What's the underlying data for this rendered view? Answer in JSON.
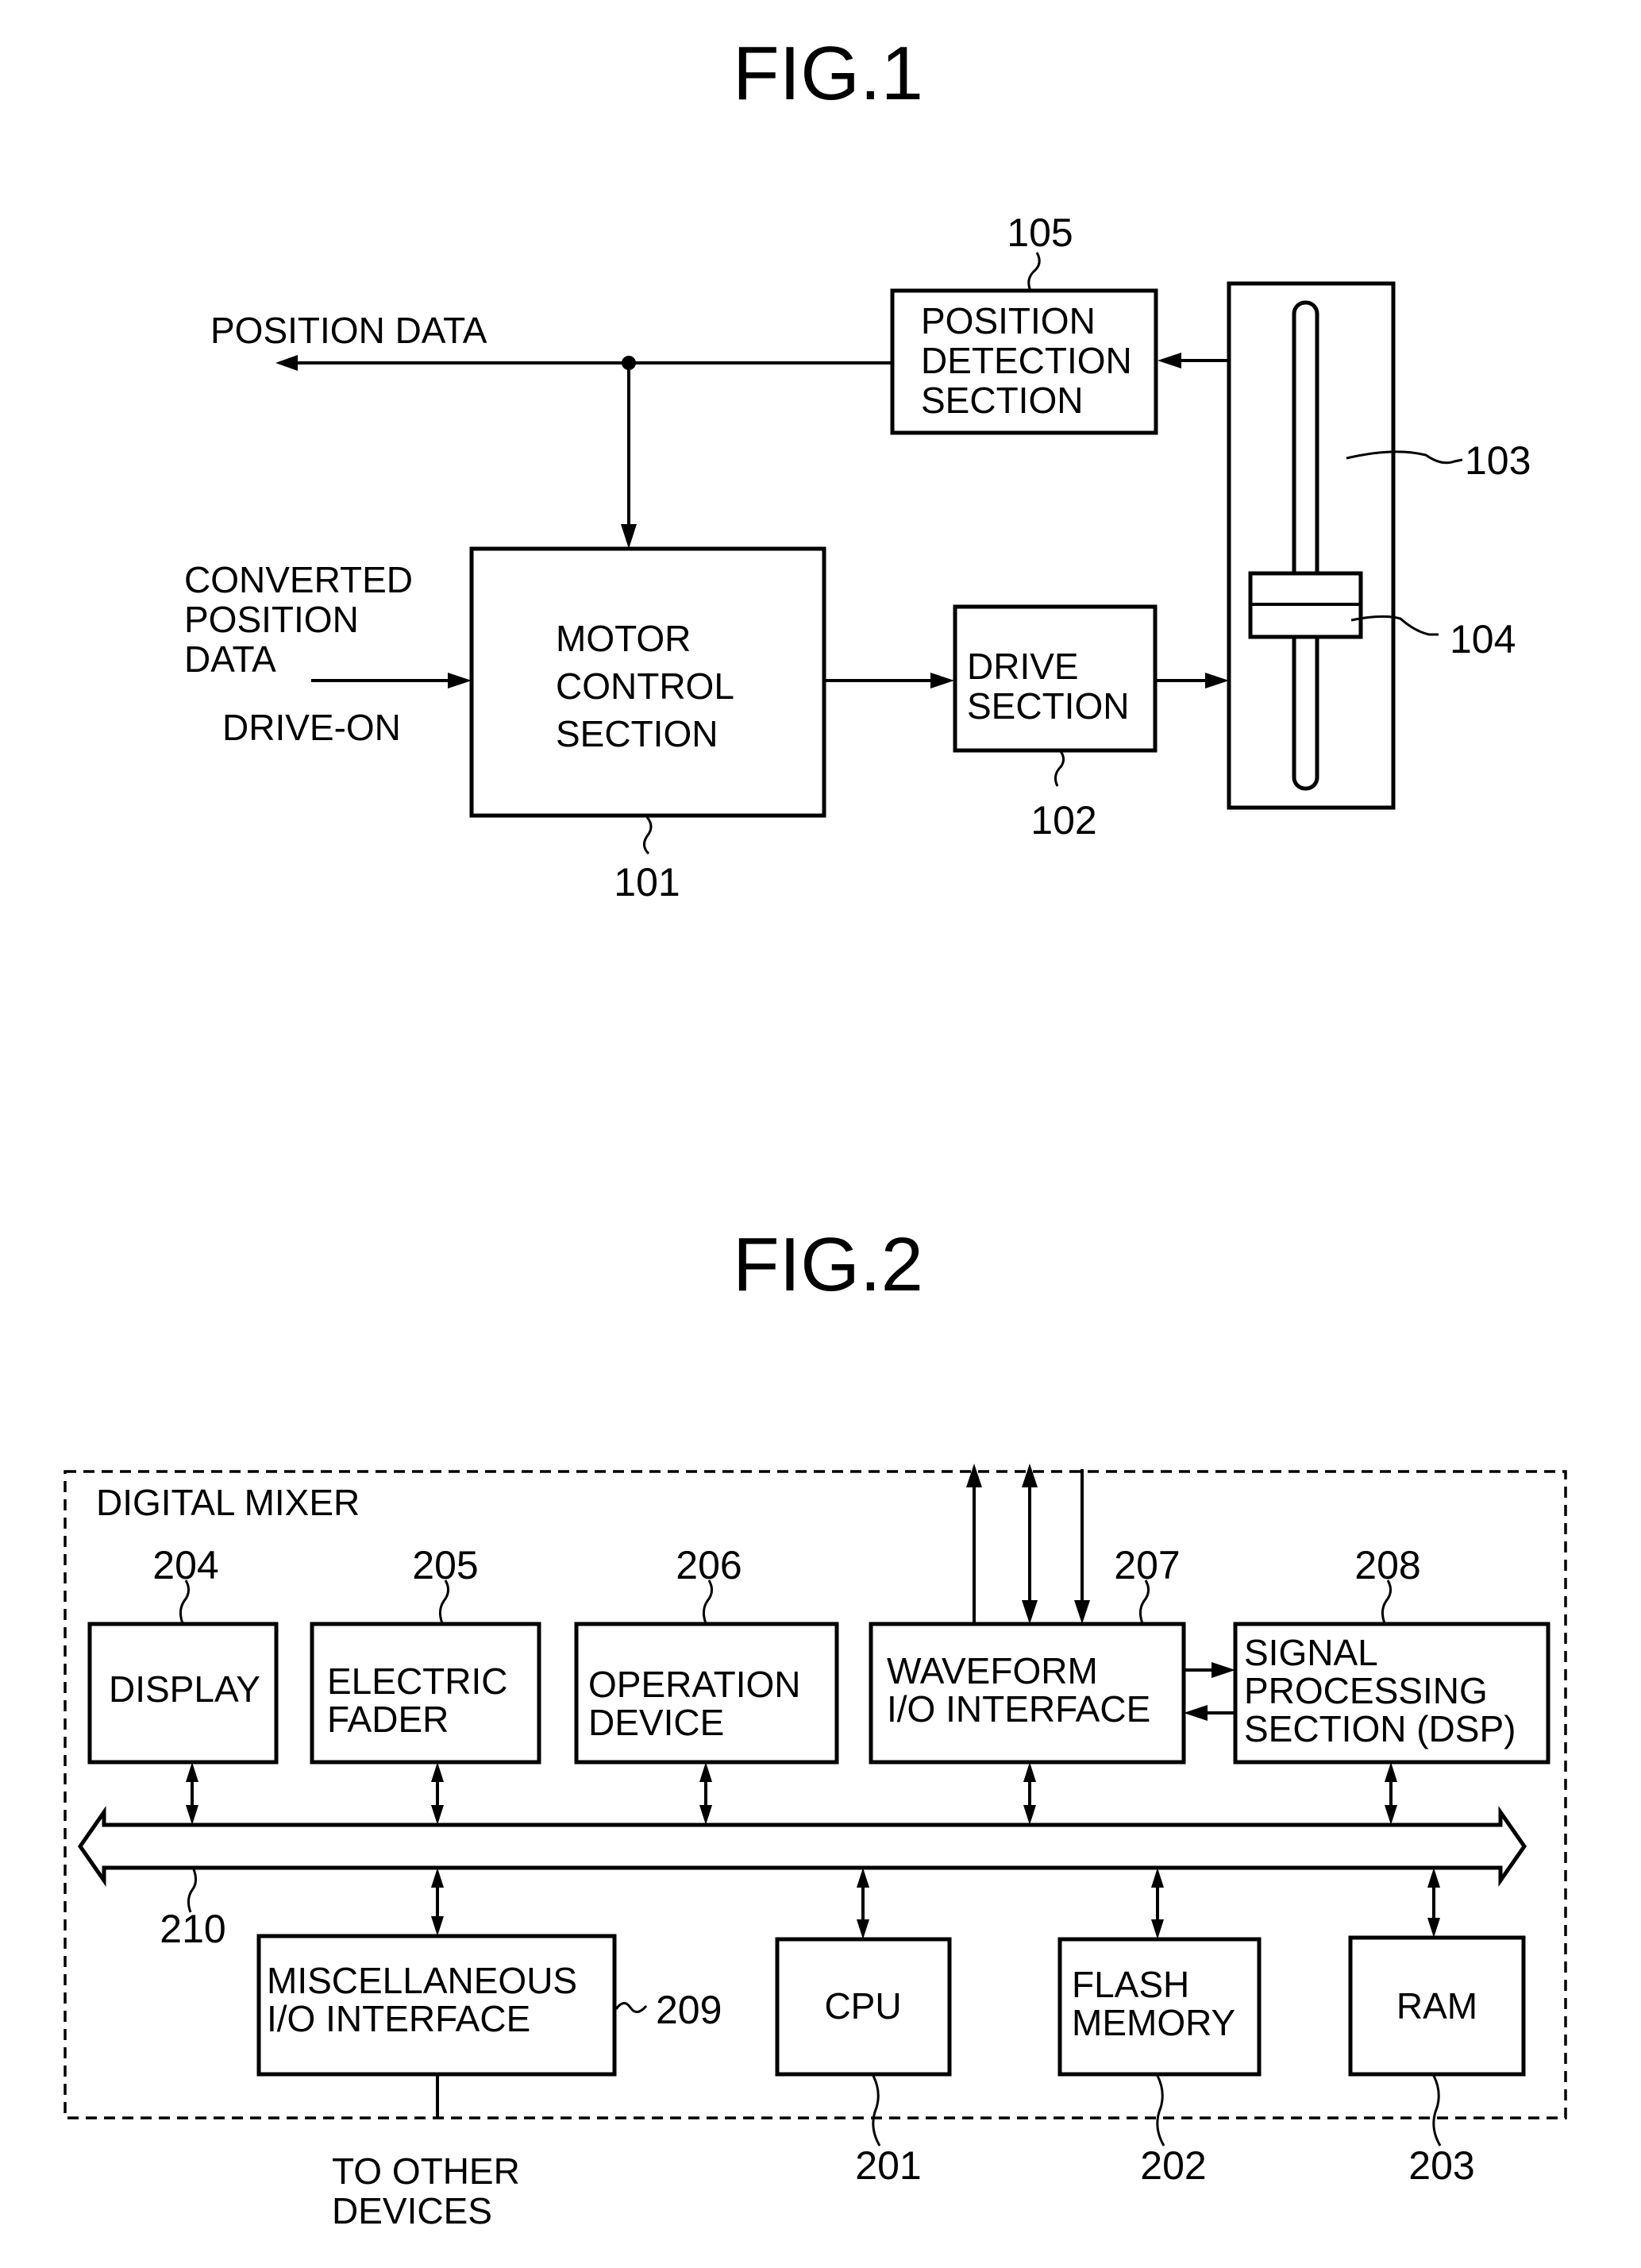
{
  "fig1": {
    "title": "FIG.1",
    "position_data_label": "POSITION DATA",
    "converted_position_data": [
      "CONVERTED",
      "POSITION",
      "DATA"
    ],
    "drive_on_label": "DRIVE-ON",
    "motor_control": {
      "lines": [
        "MOTOR",
        "CONTROL",
        "SECTION"
      ],
      "ref": "101"
    },
    "drive_section": {
      "lines": [
        "DRIVE",
        "SECTION"
      ],
      "ref": "102"
    },
    "fader": {
      "ref": "103"
    },
    "knob": {
      "ref": "104"
    },
    "position_detection": {
      "lines": [
        "POSITION",
        "DETECTION",
        "SECTION"
      ],
      "ref": "105"
    }
  },
  "fig2": {
    "title": "FIG.2",
    "container_label": "DIGITAL MIXER",
    "top_blocks": [
      {
        "lines": [
          "DISPLAY"
        ],
        "ref": "204"
      },
      {
        "lines": [
          "ELECTRIC",
          "FADER"
        ],
        "ref": "205"
      },
      {
        "lines": [
          "OPERATION",
          "DEVICE"
        ],
        "ref": "206"
      },
      {
        "lines": [
          "WAVEFORM",
          "I/O INTERFACE"
        ],
        "ref": "207"
      },
      {
        "lines": [
          "SIGNAL",
          "PROCESSING",
          "SECTION (DSP)"
        ],
        "ref": "208"
      }
    ],
    "bus": {
      "ref": "210"
    },
    "bottom_blocks": [
      {
        "lines": [
          "MISCELLANEOUS",
          "I/O INTERFACE"
        ],
        "ref": "209"
      },
      {
        "lines": [
          "CPU"
        ],
        "ref": "201"
      },
      {
        "lines": [
          "FLASH",
          "MEMORY"
        ],
        "ref": "202"
      },
      {
        "lines": [
          "RAM"
        ],
        "ref": "203"
      }
    ],
    "external_label": [
      "TO OTHER",
      "DEVICES"
    ]
  }
}
